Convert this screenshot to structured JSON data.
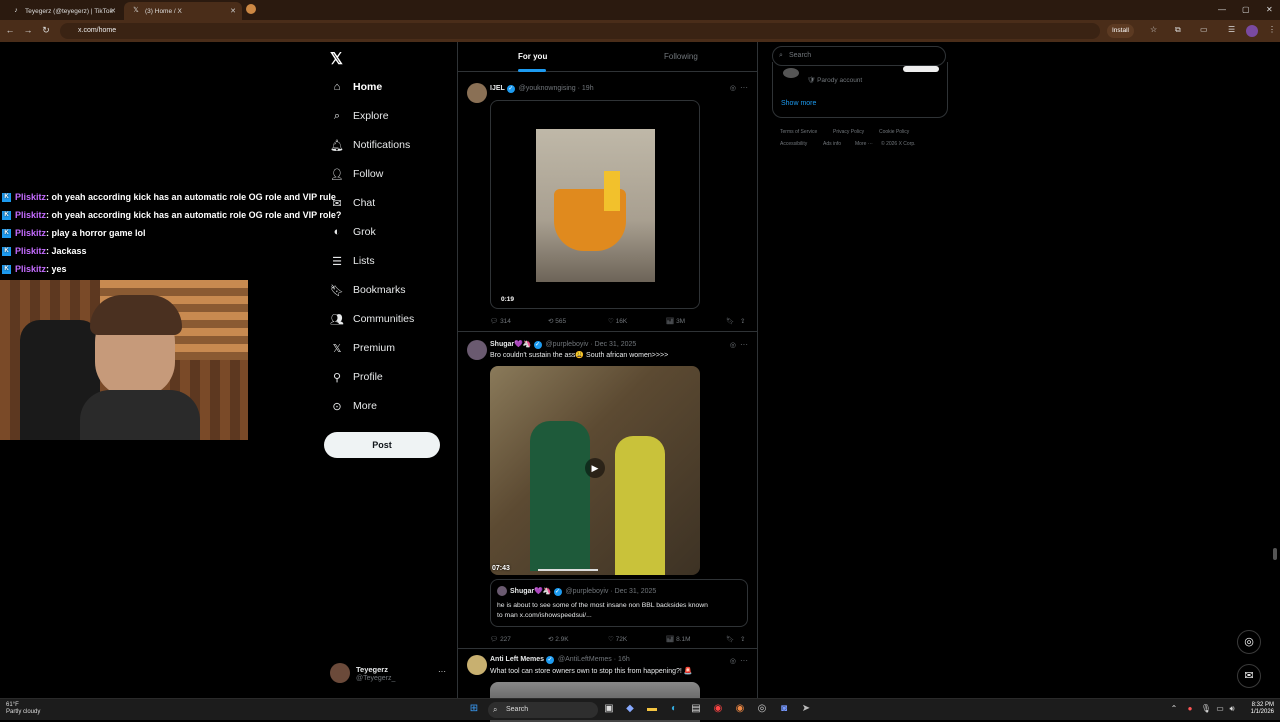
{
  "browser": {
    "tabs": [
      {
        "label": "Teyegerz (@teyegerz) | TikTok",
        "active": false
      },
      {
        "label": "(3) Home / X",
        "active": true
      }
    ],
    "url": "x.com/home",
    "install_label": "Install"
  },
  "x_nav": {
    "items": [
      {
        "label": "Home",
        "icon": "home-icon"
      },
      {
        "label": "Explore",
        "icon": "search-icon"
      },
      {
        "label": "Notifications",
        "icon": "bell-icon"
      },
      {
        "label": "Follow",
        "icon": "follow-icon"
      },
      {
        "label": "Chat",
        "icon": "chat-icon"
      },
      {
        "label": "Grok",
        "icon": "grok-icon"
      },
      {
        "label": "Lists",
        "icon": "list-icon"
      },
      {
        "label": "Bookmarks",
        "icon": "bookmark-icon"
      },
      {
        "label": "Communities",
        "icon": "communities-icon"
      },
      {
        "label": "Premium",
        "icon": "x-icon"
      },
      {
        "label": "Profile",
        "icon": "profile-icon"
      },
      {
        "label": "More",
        "icon": "more-icon"
      }
    ],
    "post_label": "Post",
    "account": {
      "name": "Teyegerz",
      "handle": "@Teyegerz_"
    }
  },
  "feed": {
    "tabs": [
      "For you",
      "Following"
    ],
    "posts": [
      {
        "name": "IJEL",
        "handle": "@youknowngising",
        "time": "19h",
        "text": "",
        "video_time": "0:19",
        "stats": {
          "replies": "314",
          "reposts": "565",
          "likes": "16K",
          "views": "3M"
        }
      },
      {
        "name": "Shugar💜🦄",
        "handle": "@purpleboyiv",
        "time": "Dec 31, 2025",
        "text": "Bro couldn't sustain the ass😩 South african women>>>>",
        "video_time": "07:43",
        "quote": {
          "name": "Shugar💜🦄",
          "handle": "@purpleboyiv",
          "time": "Dec 31, 2025",
          "text_line1": "he is about to see some of the most insane non BBL backsides known",
          "text_line2": "to man x.com/ishowspeedsui/..."
        },
        "stats": {
          "replies": "227",
          "reposts": "2.9K",
          "likes": "72K",
          "views": "8.1M"
        }
      },
      {
        "name": "Anti Left Memes",
        "handle": "@AntiLeftMemes",
        "time": "16h",
        "text": "What tool can store owners own to stop this from happening?! 🚨"
      }
    ]
  },
  "right": {
    "search_placeholder": "Search",
    "trend_sub": "Parody account",
    "show_more": "Show more",
    "footer": [
      "Terms of Service",
      "Privacy Policy",
      "Cookie Policy",
      "Accessibility",
      "Ads info",
      "More ···",
      "© 2026 X Corp."
    ]
  },
  "chat_overlay": [
    {
      "user": "Pliskitz",
      "msg": ": oh yeah according kick has an automatic role OG role and VIP rule"
    },
    {
      "user": "Pliskitz",
      "msg": ": oh yeah according kick has an automatic role OG role and VIP role?"
    },
    {
      "user": "Pliskitz",
      "msg": ": play a horror game lol"
    },
    {
      "user": "Pliskitz",
      "msg": ": Jackass"
    },
    {
      "user": "Pliskitz",
      "msg": ": yes"
    }
  ],
  "taskbar": {
    "weather_temp": "61°F",
    "weather_desc": "Partly cloudy",
    "search_label": "Search",
    "time": "8:32 PM",
    "date": "1/1/2026"
  },
  "colors": {
    "accent": "#1d9bf0",
    "chrome": "#4a2d19",
    "chat_user": "#c46cff"
  }
}
